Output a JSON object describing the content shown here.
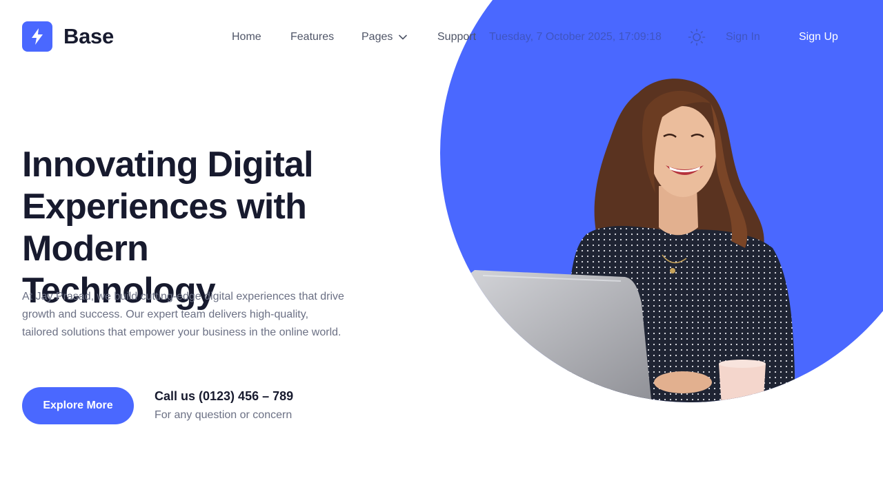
{
  "brand": {
    "name": "Base",
    "icon": "lightning-bolt-icon",
    "accent_color": "#4a68ff"
  },
  "nav": {
    "items": [
      {
        "label": "Home"
      },
      {
        "label": "Features"
      },
      {
        "label": "Pages",
        "icon": "chevron-down-icon"
      },
      {
        "label": "Support"
      }
    ],
    "datetime": "Tuesday, 7 October 2025, 17:09:18",
    "theme_icon": "sun-icon",
    "sign_in": "Sign In",
    "sign_up": "Sign Up"
  },
  "hero": {
    "headline_line1": "Innovating Digital",
    "headline_line2": "Experiences with Modern",
    "headline_line3": "Technology",
    "description": "At Jay Prasad, we build cutting-edge digital experiences that drive growth and success. Our expert team delivers high-quality, tailored solutions that empower your business in the online world.",
    "cta_label": "Explore More",
    "call_label": "Call us (0123) 456 – 789",
    "call_sub": "For any question or concern",
    "image": "woman-laughing-with-laptop-photo"
  }
}
